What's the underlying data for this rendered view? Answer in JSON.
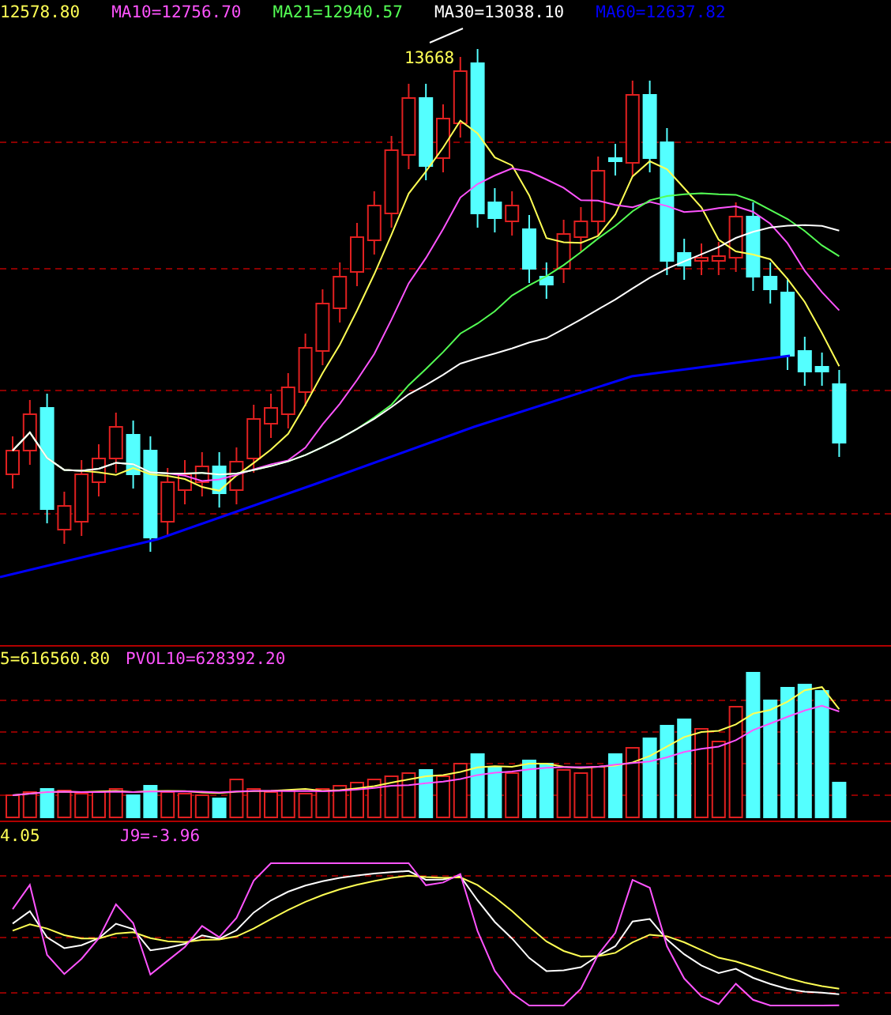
{
  "price_panel": {
    "indicators": [
      {
        "label": "12578.80",
        "color": "#ffff54"
      },
      {
        "label": "MA10=12756.70",
        "color": "#ff54ff"
      },
      {
        "label": "MA21=12940.57",
        "color": "#54ff54"
      },
      {
        "label": "MA30=13038.10",
        "color": "#ffffff"
      },
      {
        "label": "MA60=12637.82",
        "color": "#0000ff"
      }
    ],
    "peak_label": "13668"
  },
  "volume_panel": {
    "indicators": [
      {
        "label": "5=616560.80",
        "color": "#ffff54"
      },
      {
        "label": "PVOL10=628392.20",
        "color": "#ff54ff"
      }
    ]
  },
  "kdj_panel": {
    "indicators": [
      {
        "label": "4.05",
        "color": "#ffff54"
      },
      {
        "label": "J9=-3.96",
        "color": "#ff54ff"
      }
    ]
  }
}
